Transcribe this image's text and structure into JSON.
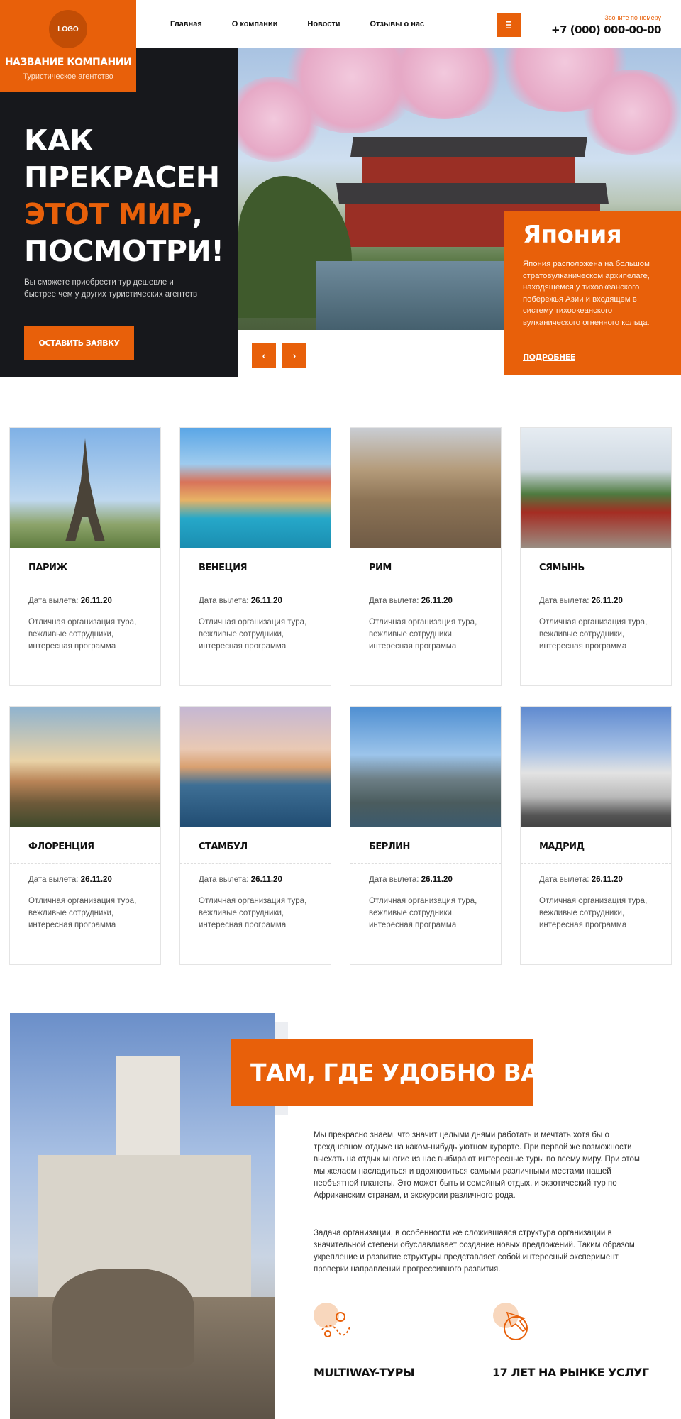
{
  "header": {
    "logo_text": "LOGO",
    "company_name": "НАЗВАНИЕ КОМПАНИИ",
    "company_subtitle": "Туристическое агентство",
    "nav": [
      "Главная",
      "О компании",
      "Новости",
      "Отзывы о нас"
    ],
    "menu_icon": "hamburger-icon",
    "call_label": "Звоните по номеру",
    "phone": "+7 (000) 000-00-00"
  },
  "hero": {
    "title_line1": "КАК",
    "title_line2": "ПРЕКРАСЕН",
    "title_line3_accent": "ЭТОТ МИР",
    "title_line3_rest": ",",
    "title_line4": "ПОСМОТРИ!",
    "text": "Вы сможете приобрести тур дешевле и быстрее чем у других туристических агентств",
    "cta": "ОСТАВИТЬ ЗАЯВКУ",
    "prev_icon": "chevron-left-icon",
    "next_icon": "chevron-right-icon",
    "prev_glyph": "‹",
    "next_glyph": "›",
    "destination": {
      "title": "Япония",
      "text": "Япония расположена на большом стратовулканическом архипелаге, находящемся у тихоокеанского побережья Азии и входящем в систему тихоокеанского вулканического огненного кольца.",
      "more": "ПОДРОБНЕЕ"
    }
  },
  "tours": {
    "date_label": "Дата вылета:",
    "items": [
      {
        "city": "ПАРИЖ",
        "date": "26.11.20",
        "desc": "Отличная организация тура, вежливые сотрудники, интересная программа"
      },
      {
        "city": "ВЕНЕЦИЯ",
        "date": "26.11.20",
        "desc": "Отличная организация тура, вежливые сотрудники, интересная программа"
      },
      {
        "city": "РИМ",
        "date": "26.11.20",
        "desc": "Отличная организация тура, вежливые сотрудники, интересная программа"
      },
      {
        "city": "СЯМЫНЬ",
        "date": "26.11.20",
        "desc": "Отличная организация тура, вежливые сотрудники, интересная программа"
      },
      {
        "city": "ФЛОРЕНЦИЯ",
        "date": "26.11.20",
        "desc": "Отличная организация тура, вежливые сотрудники, интересная программа"
      },
      {
        "city": "СТАМБУЛ",
        "date": "26.11.20",
        "desc": "Отличная организация тура, вежливые сотрудники, интересная программа"
      },
      {
        "city": "БЕРЛИН",
        "date": "26.11.20",
        "desc": "Отличная организация тура, вежливые сотрудники, интересная программа"
      },
      {
        "city": "МАДРИД",
        "date": "26.11.20",
        "desc": "Отличная организация тура, вежливые сотрудники, интересная программа"
      }
    ]
  },
  "about": {
    "title": "ТАМ, ГДЕ УДОБНО ВАМ",
    "p1": "Мы прекрасно знаем, что значит целыми днями работать и мечтать хотя бы о трехдневном отдыхе на каком-нибудь уютном курорте. При первой же возможности выехать на отдых многие из нас выбирают интересные туры по всему миру. При этом мы желаем насладиться и вдохновиться самыми различными местами нашей необъятной планеты. Это может быть и семейный отдых, и экзотический тур по Африканским странам, и экскурсии различного рода.",
    "p2": "Задача организации, в особенности же сложившаяся структура организации в значительной степени обуславливает создание новых предложений. Таким образом укрепление и развитие структуры представляет собой интересный эксперимент проверки направлений прогрессивного развития.",
    "features": [
      {
        "icon": "map-route-icon",
        "label": "MULTIWAY-ТУРЫ"
      },
      {
        "icon": "airplane-globe-icon",
        "label": "17 ЛЕТ НА РЫНКЕ УСЛУГ"
      }
    ]
  },
  "colors": {
    "accent": "#e8600a",
    "dark": "#17181c"
  }
}
